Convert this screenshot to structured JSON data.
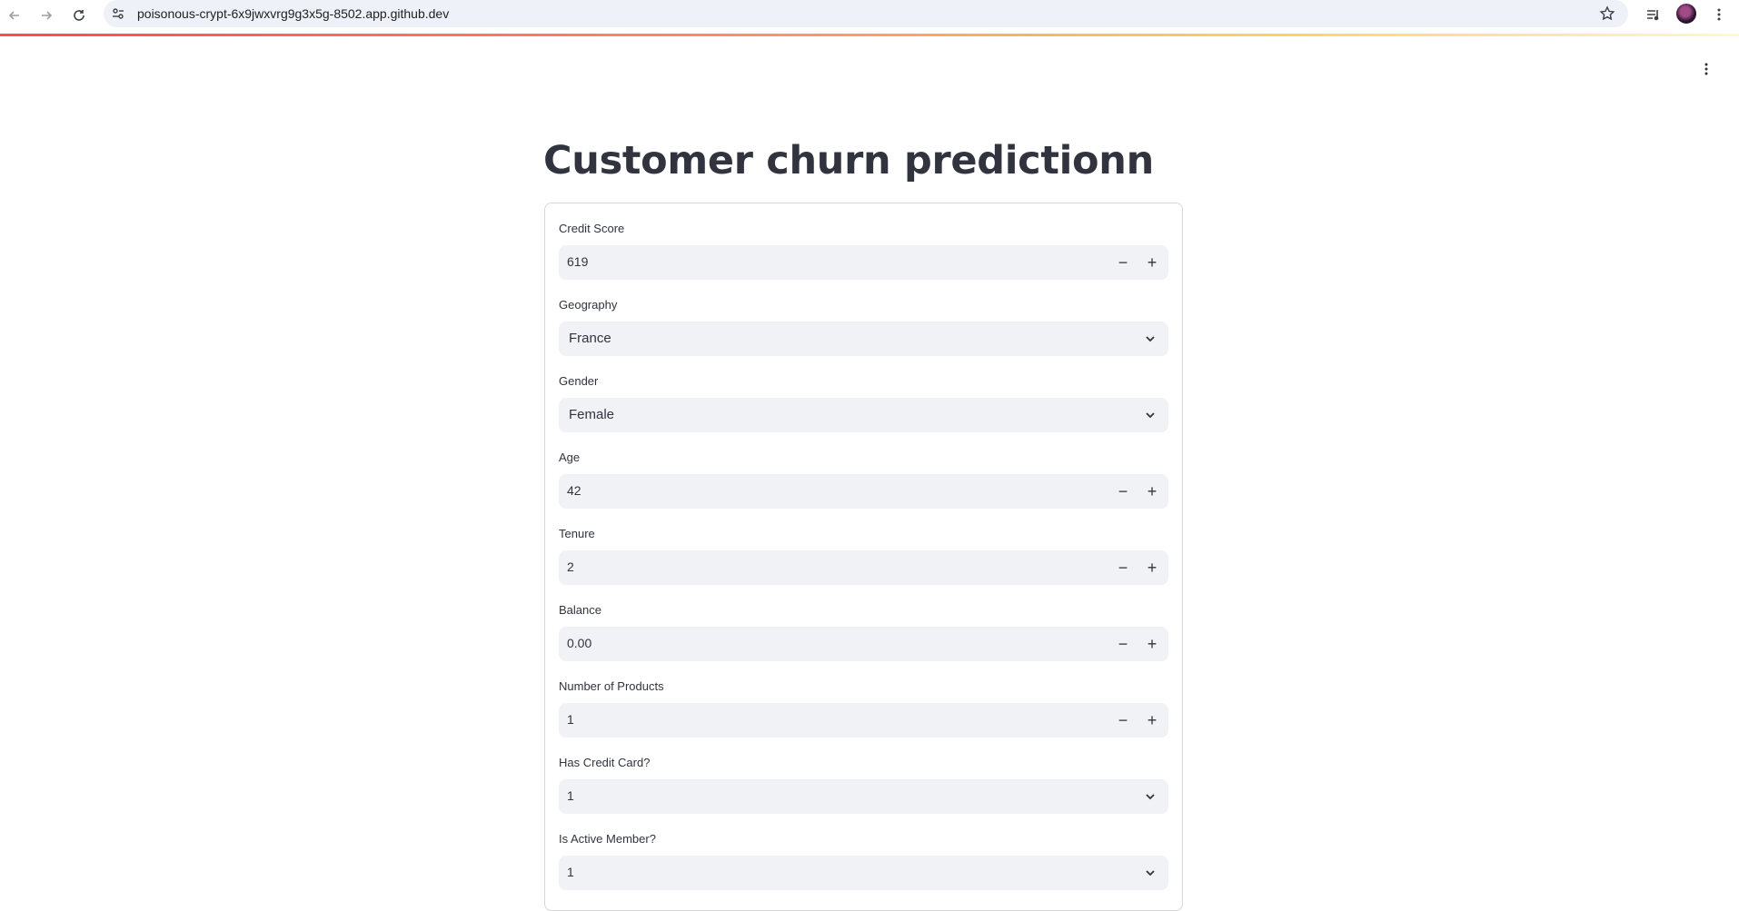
{
  "browser": {
    "url": "poisonous-crypt-6x9jwxvrg9g3x5g-8502.app.github.dev"
  },
  "page": {
    "title": "Customer churn predictionn"
  },
  "form": {
    "credit_score": {
      "label": "Credit Score",
      "value": "619"
    },
    "geography": {
      "label": "Geography",
      "value": "France"
    },
    "gender": {
      "label": "Gender",
      "value": "Female"
    },
    "age": {
      "label": "Age",
      "value": "42"
    },
    "tenure": {
      "label": "Tenure",
      "value": "2"
    },
    "balance": {
      "label": "Balance",
      "value": "0.00"
    },
    "num_products": {
      "label": "Number of Products",
      "value": "1"
    },
    "has_credit_card": {
      "label": "Has Credit Card?",
      "value": "1"
    },
    "is_active_member": {
      "label": "Is Active Member?",
      "value": "1"
    }
  },
  "icons": {
    "minus": "−",
    "plus": "+"
  }
}
